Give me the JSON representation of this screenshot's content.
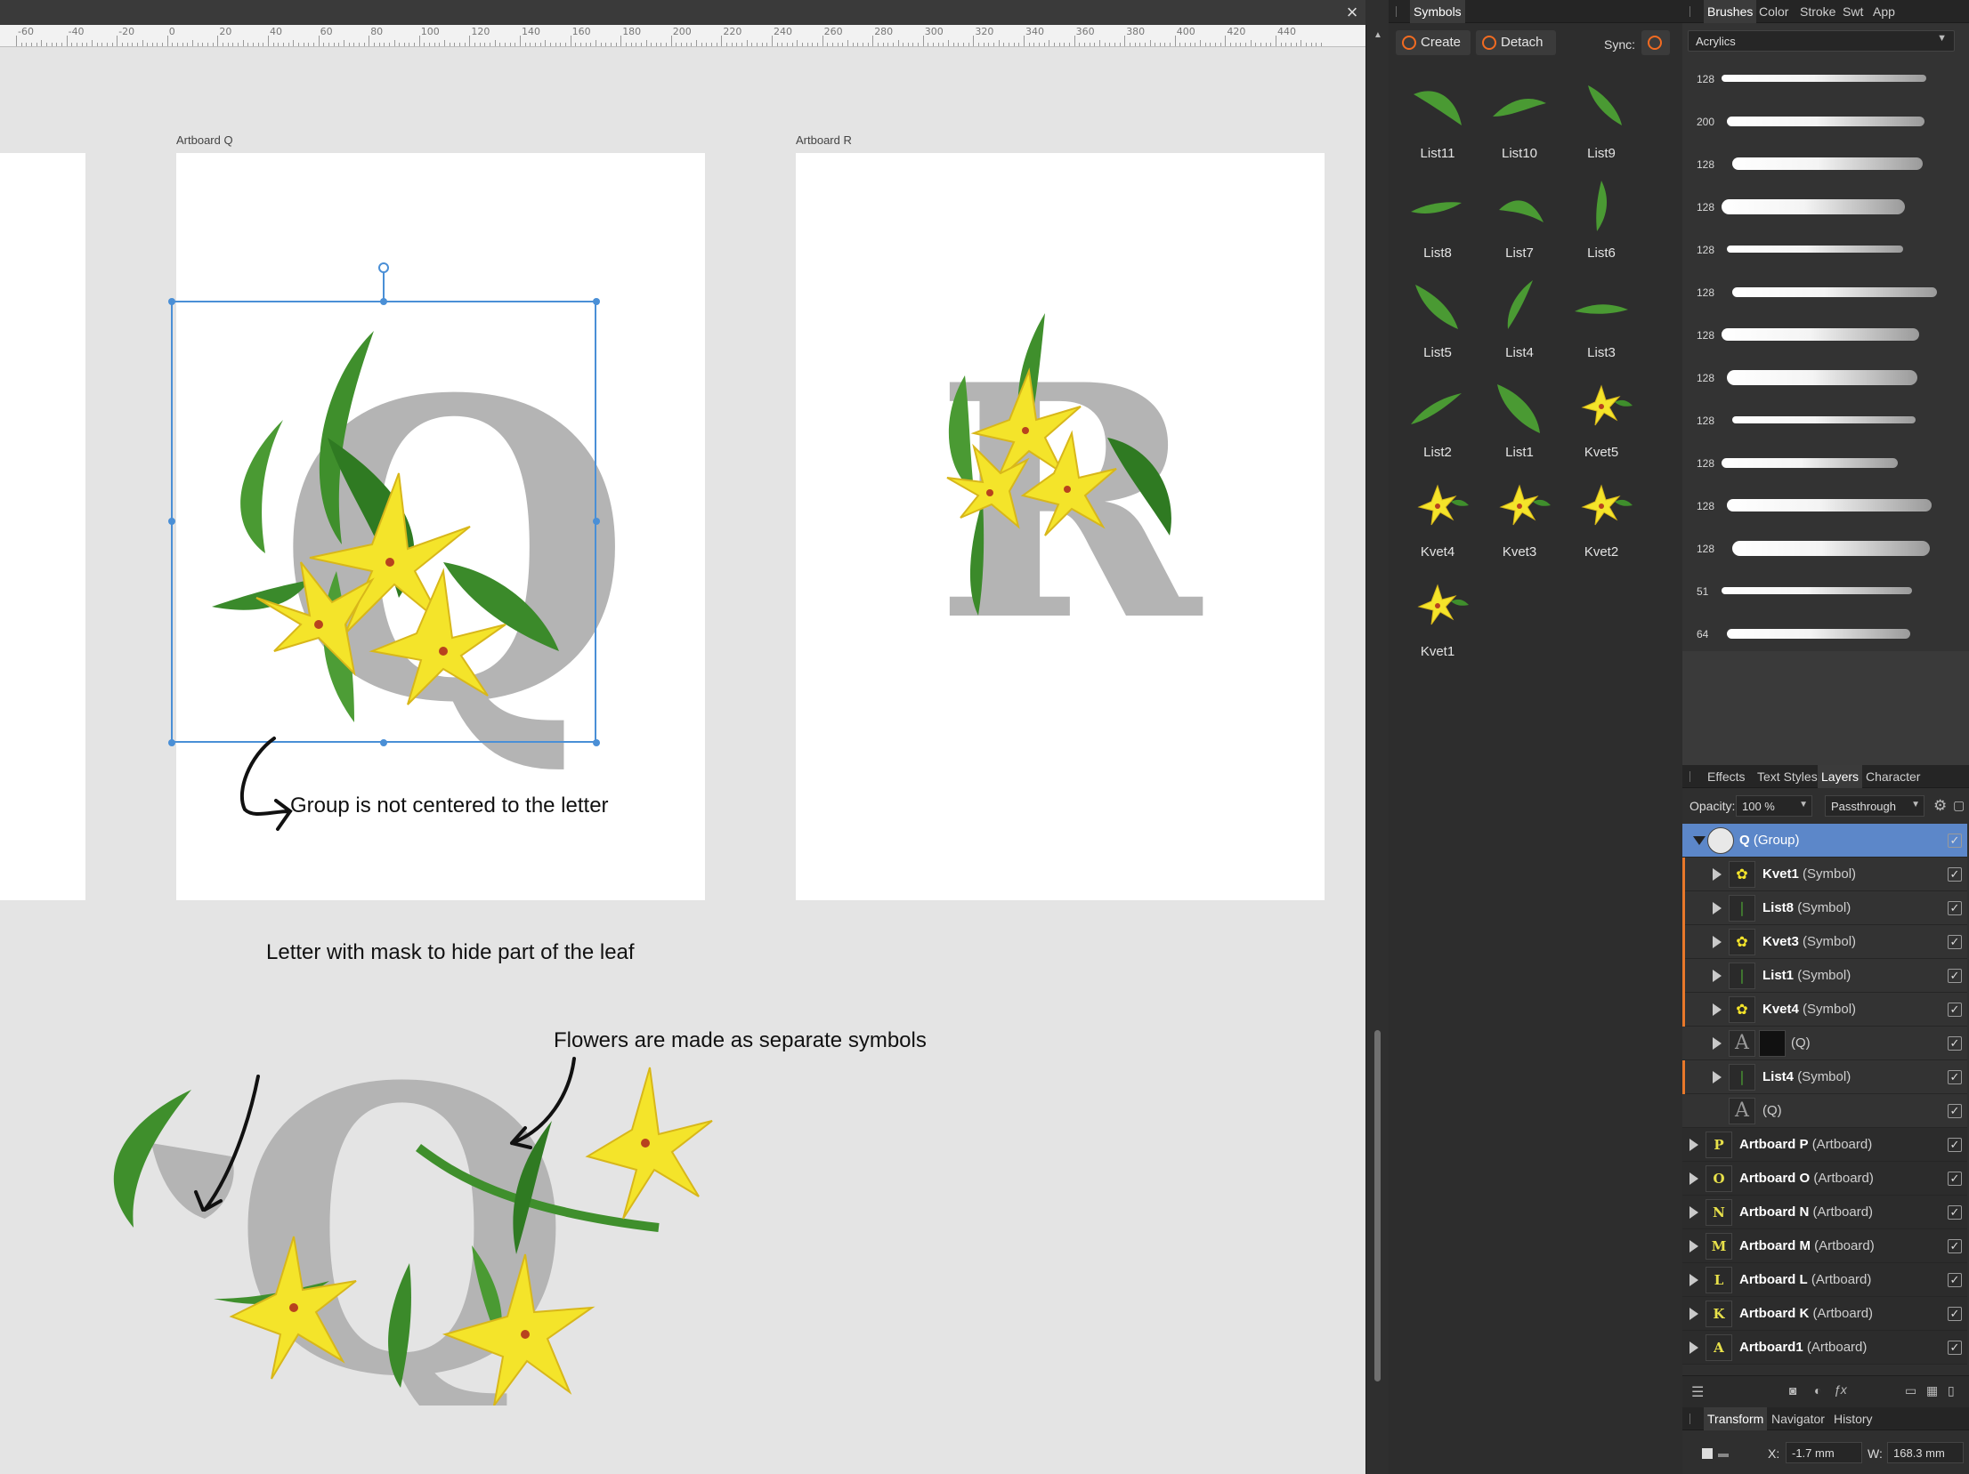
{
  "canvas": {
    "ruler_labels": [
      "-60",
      "-40",
      "-20",
      "0",
      "20",
      "40",
      "60",
      "80",
      "100",
      "120",
      "140",
      "160",
      "180",
      "200",
      "220",
      "240",
      "260",
      "280",
      "300",
      "320",
      "340",
      "360",
      "380",
      "400",
      "420",
      "440"
    ],
    "artboard_q_label": "Artboard Q",
    "artboard_r_label": "Artboard R",
    "letter_q": "Q",
    "letter_r": "R",
    "annotation_group": "Group  is not centered to the letter",
    "annotation_mask": "Letter with mask to hide part of the leaf",
    "annotation_flowers": "Flowers are made as separate symbols",
    "close_glyph": "×"
  },
  "symbols_panel": {
    "tab": "Symbols",
    "create_label": "Create",
    "detach_label": "Detach",
    "sync_label": "Sync:",
    "items": [
      {
        "label": "List11",
        "kind": "leaf"
      },
      {
        "label": "List10",
        "kind": "leaf"
      },
      {
        "label": "List9",
        "kind": "leaf"
      },
      {
        "label": "List8",
        "kind": "leaf"
      },
      {
        "label": "List7",
        "kind": "leaf"
      },
      {
        "label": "List6",
        "kind": "leaf"
      },
      {
        "label": "List5",
        "kind": "leaf"
      },
      {
        "label": "List4",
        "kind": "leaf"
      },
      {
        "label": "List3",
        "kind": "leaf"
      },
      {
        "label": "List2",
        "kind": "leaf"
      },
      {
        "label": "List1",
        "kind": "leaf"
      },
      {
        "label": "Kvet5",
        "kind": "flower"
      },
      {
        "label": "Kvet4",
        "kind": "flower"
      },
      {
        "label": "Kvet3",
        "kind": "flower"
      },
      {
        "label": "Kvet2",
        "kind": "flower"
      },
      {
        "label": "Kvet1",
        "kind": "flower"
      }
    ]
  },
  "brushes_panel": {
    "tabs": [
      "Brushes",
      "Color",
      "Stroke",
      "Swt",
      "App"
    ],
    "category": "Acrylics",
    "sizes": [
      "128",
      "200",
      "128",
      "128",
      "128",
      "128",
      "128",
      "128",
      "128",
      "128",
      "128",
      "128",
      "51",
      "64"
    ]
  },
  "layers_panel": {
    "tabs": [
      "Effects",
      "Text Styles",
      "Layers",
      "Character"
    ],
    "opacity_label": "Opacity:",
    "opacity_value": "100 %",
    "blend_mode": "Passthrough",
    "group_name": "Q",
    "group_type": "(Group)",
    "children": [
      {
        "name": "Kvet1",
        "type": "(Symbol)",
        "icon": "flower",
        "orange": true,
        "thumb": "✿"
      },
      {
        "name": "List8",
        "type": "(Symbol)",
        "icon": "leaf",
        "orange": true,
        "thumb": "❘"
      },
      {
        "name": "Kvet3",
        "type": "(Symbol)",
        "icon": "flower",
        "orange": true,
        "thumb": "✿"
      },
      {
        "name": "List1",
        "type": "(Symbol)",
        "icon": "leaf",
        "orange": true,
        "thumb": "❘"
      },
      {
        "name": "Kvet4",
        "type": "(Symbol)",
        "icon": "flower",
        "orange": true,
        "thumb": "✿"
      },
      {
        "name": "",
        "type": "(Q)",
        "icon": "text",
        "orange": false,
        "thumb": "A"
      },
      {
        "name": "List4",
        "type": "(Symbol)",
        "icon": "leaf",
        "orange": true,
        "thumb": "❘"
      },
      {
        "name": "",
        "type": "(Q)",
        "icon": "text",
        "orange": false,
        "thumb": "A"
      }
    ],
    "artboards": [
      {
        "name": "Artboard P",
        "type": "(Artboard)",
        "thumb": "P"
      },
      {
        "name": "Artboard O",
        "type": "(Artboard)",
        "thumb": "O"
      },
      {
        "name": "Artboard N",
        "type": "(Artboard)",
        "thumb": "N"
      },
      {
        "name": "Artboard M",
        "type": "(Artboard)",
        "thumb": "M"
      },
      {
        "name": "Artboard L",
        "type": "(Artboard)",
        "thumb": "L"
      },
      {
        "name": "Artboard K",
        "type": "(Artboard)",
        "thumb": "K"
      },
      {
        "name": "Artboard1",
        "type": "(Artboard)",
        "thumb": "A"
      }
    ],
    "check_glyph": "✓"
  },
  "bottom_panel": {
    "tabs": [
      "Transform",
      "Navigator",
      "History"
    ],
    "x_label": "X:",
    "x_value": "-1.7 mm",
    "w_label": "W:",
    "w_value": "168.3 mm"
  },
  "colors": {
    "accent_orange": "#f26b21",
    "selection_blue": "#4a8fd6",
    "layer_selected": "#5c87c9",
    "letter_gray": "#b4b4b4",
    "flower_yellow": "#f4e42a",
    "leaf_green": "#3f8f2c"
  }
}
